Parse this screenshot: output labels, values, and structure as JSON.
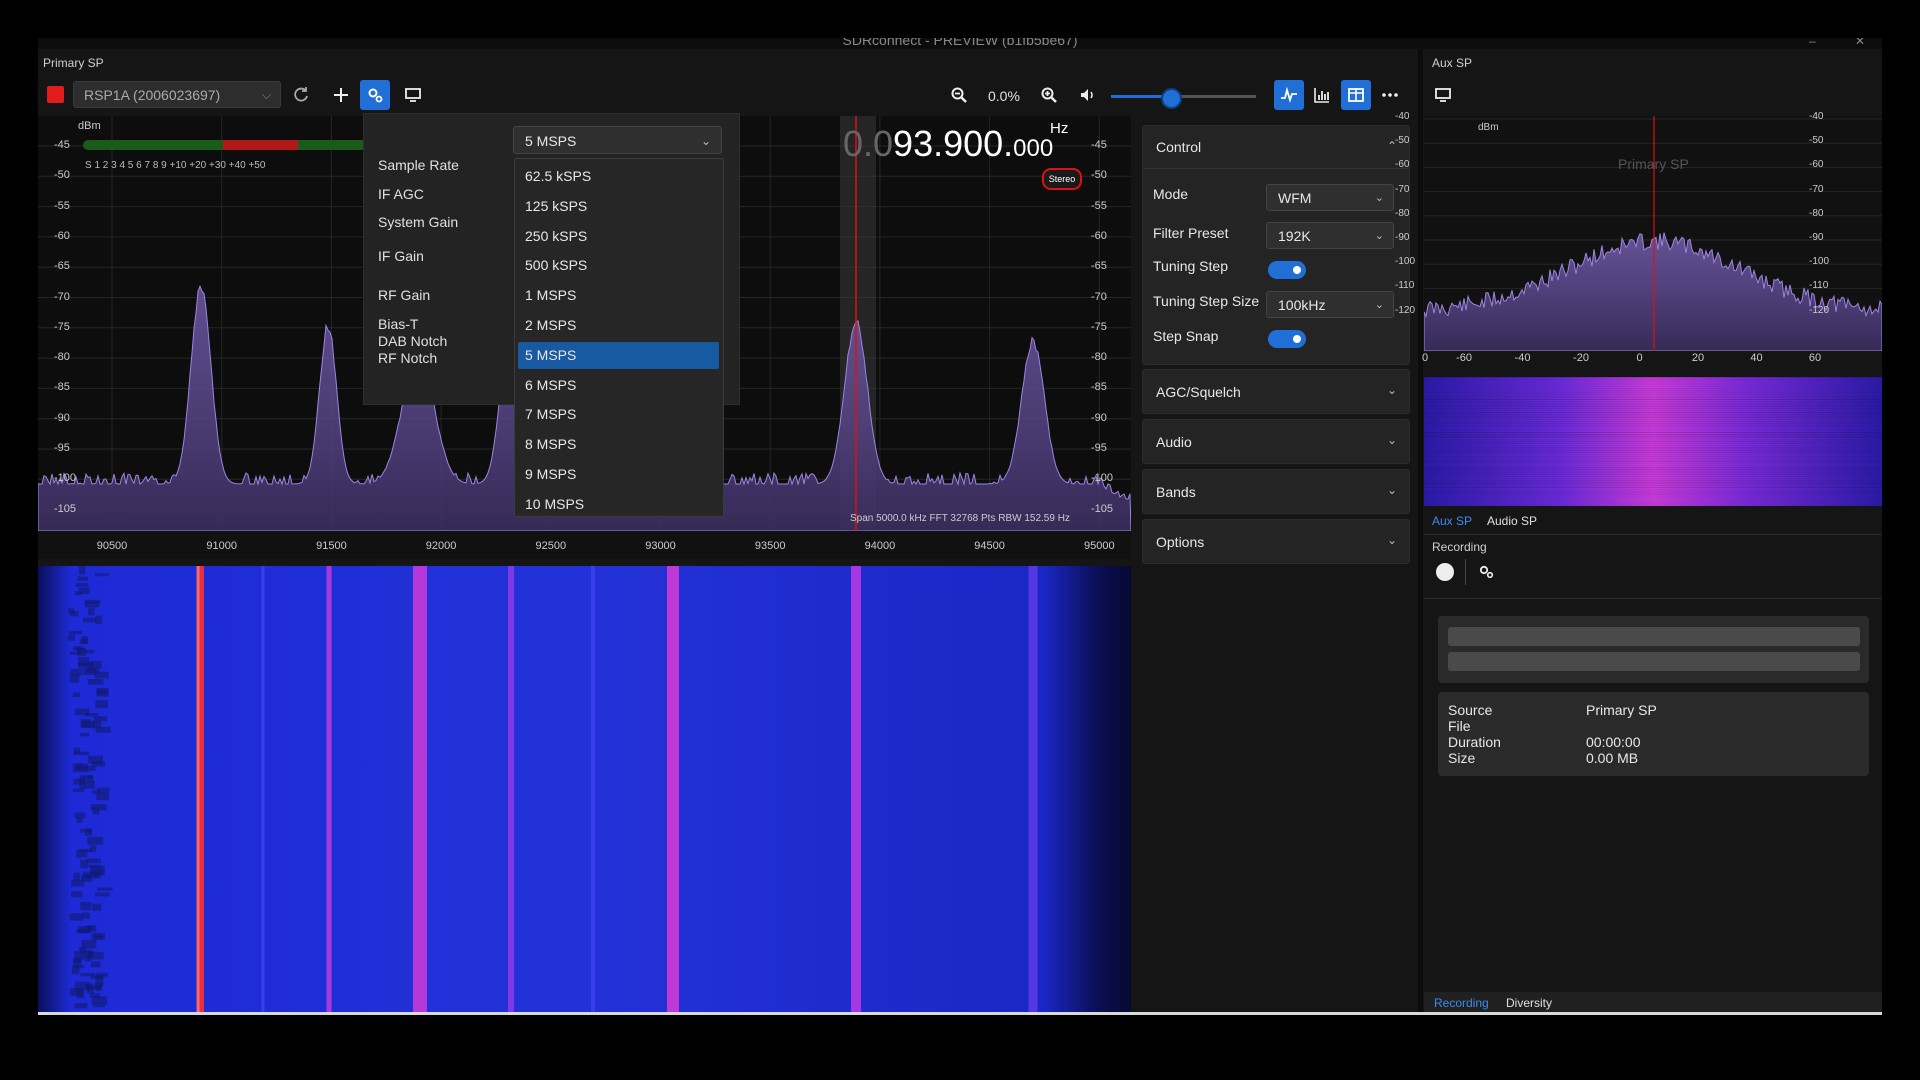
{
  "window": {
    "title": "SDRconnect - PREVIEW (b1fb5be67)",
    "min_glyph": "–",
    "close_glyph": "✕"
  },
  "primary": {
    "label": "Primary SP",
    "device": "RSP1A (2006023697)",
    "zoom": "0.0%",
    "volume_fraction": 0.41,
    "freq": {
      "dim": "0.0",
      "main": "93.900.",
      "small": "000",
      "unit": "Hz"
    },
    "stereo": "Stereo",
    "span_info": "Span 5000.0 kHz FFT 32768 Pts  RBW 152.59 Hz",
    "dbm_unit": "dBm",
    "smeter_scale": "S  1   2   3   4   5   6   7   8   9  +10  +20  +30  +40  +50",
    "db_ticks": [
      "-45",
      "-50",
      "-55",
      "-60",
      "-65",
      "-70",
      "-75",
      "-80",
      "-85",
      "-90",
      "-95",
      "-100",
      "-105"
    ],
    "freq_ticks": [
      "90500",
      "91000",
      "91500",
      "92000",
      "92500",
      "93000",
      "93500",
      "94000",
      "94500",
      "95000"
    ]
  },
  "settings_popover": {
    "sample_rate_label": "Sample Rate",
    "if_agc_label": "IF AGC",
    "system_gain_label": "System Gain",
    "if_gain_label": "IF Gain",
    "rf_gain_label": "RF Gain",
    "bias_t_label": "Bias-T",
    "dab_notch_label": "DAB Notch",
    "rf_notch_label": "RF Notch",
    "sample_rate_value": "5 MSPS",
    "options": [
      "62.5 kSPS",
      "125 kSPS",
      "250 kSPS",
      "500 kSPS",
      "1 MSPS",
      "2 MSPS",
      "5 MSPS",
      "6 MSPS",
      "7 MSPS",
      "8 MSPS",
      "9 MSPS",
      "10 MSPS"
    ],
    "selected_index": 6
  },
  "control": {
    "title": "Control",
    "mode_label": "Mode",
    "mode_value": "WFM",
    "filter_label": "Filter Preset",
    "filter_value": "192K",
    "tuning_step_label": "Tuning Step",
    "tuning_step_size_label": "Tuning Step Size",
    "tuning_step_size_value": "100kHz",
    "step_snap_label": "Step Snap",
    "sections": [
      "AGC/Squelch",
      "Audio",
      "Bands",
      "Options"
    ]
  },
  "aux": {
    "label": "Aux SP",
    "dbm_unit": "dBm",
    "overlay": "Primary SP",
    "db_ticks": [
      "-40",
      "-50",
      "-60",
      "-70",
      "-80",
      "-90",
      "-100",
      "-110",
      "-120"
    ],
    "x_ticks": [
      "0",
      "-60",
      "-40",
      "-20",
      "0",
      "20",
      "40",
      "60"
    ],
    "tabs": [
      "Aux SP",
      "Audio SP"
    ],
    "recording_label": "Recording",
    "info": {
      "source_label": "Source",
      "source_value": "Primary SP",
      "file_label": "File",
      "duration_label": "Duration",
      "duration_value": "00:00:00",
      "size_label": "Size",
      "size_value": "0.00 MB"
    },
    "bottom_tabs": [
      "Recording",
      "Diversity"
    ]
  },
  "colors": {
    "accent": "#1f6fd6",
    "record": "#e21c1c",
    "selected_item": "#175aa1"
  }
}
